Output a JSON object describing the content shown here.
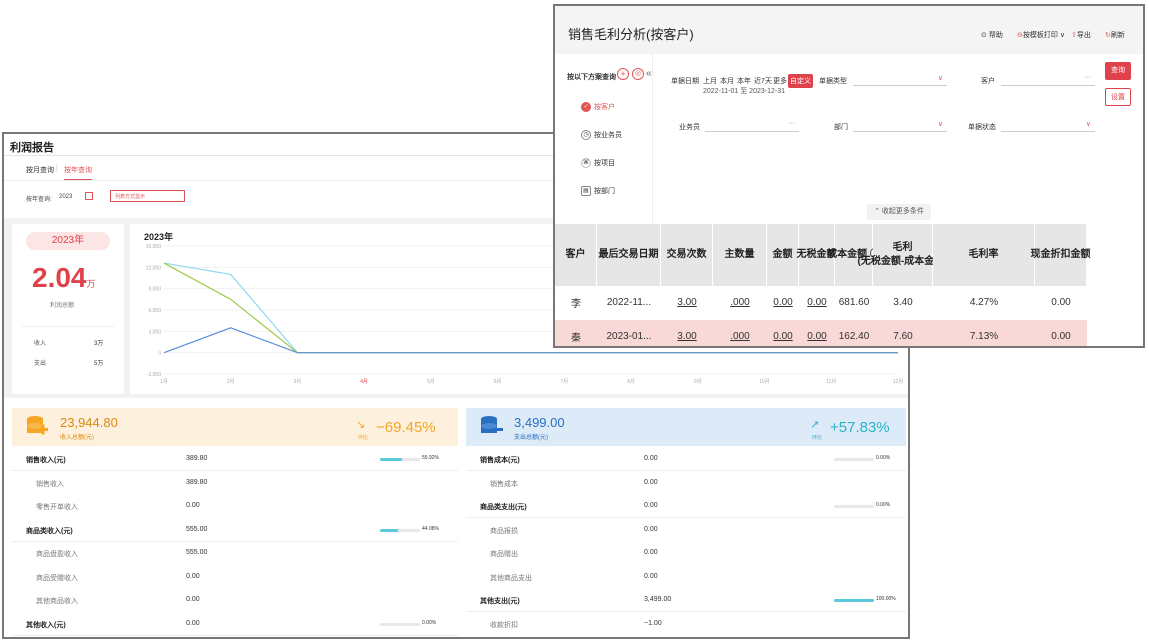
{
  "profit_report": {
    "title": "利润报告",
    "tabs": [
      "按月查询",
      "按年查询"
    ],
    "year_label": "按年查询:",
    "year_value": "2023",
    "list_btn": "列表方式显示",
    "summary": {
      "year": "2023年",
      "big_value": "2.04",
      "big_unit": "万",
      "big_label": "利润总额",
      "income_label": "收入",
      "income_value": "3万",
      "expense_label": "支出",
      "expense_value": "5万"
    },
    "chart_data": {
      "type": "line",
      "title": "2023年",
      "categories": [
        "1月",
        "2月",
        "3月",
        "4月",
        "5月",
        "6月",
        "7月",
        "8月",
        "9月",
        "10月",
        "11月",
        "12月"
      ],
      "highlight_category": "4月",
      "yticks": [
        "15,000",
        "12,000",
        "9,000",
        "6,000",
        "3,000",
        "0",
        "-3,000"
      ],
      "ylim": [
        -3000,
        15000
      ],
      "series": [
        {
          "color": "#8fd8ee",
          "values": [
            12600,
            11000,
            0,
            0,
            0,
            0,
            0,
            0,
            0,
            0,
            0,
            0
          ]
        },
        {
          "color": "#9bcb46",
          "values": [
            12600,
            7500,
            0,
            0,
            0,
            0,
            0,
            0,
            0,
            0,
            0,
            0
          ]
        },
        {
          "color": "#5b8fd9",
          "values": [
            0,
            3500,
            0,
            0,
            0,
            0,
            0,
            0,
            0,
            0,
            0,
            0
          ]
        }
      ]
    },
    "income": {
      "amount": "23,944.80",
      "amount_label": "收入总额(元)",
      "hb": "环比",
      "pct": "−69.45%",
      "rows": [
        {
          "name": "销售收入(元)",
          "value": "389.80",
          "pct": "55.92%",
          "fill": 0.56,
          "bold": true
        },
        {
          "name": "销售收入",
          "value": "389.80"
        },
        {
          "name": "零售开单收入",
          "value": "0.00"
        },
        {
          "name": "商品类收入(元)",
          "value": "555.00",
          "pct": "44.08%",
          "fill": 0.44,
          "bold": true
        },
        {
          "name": "商品盘盈收入",
          "value": "555.00"
        },
        {
          "name": "商品受赠收入",
          "value": "0.00"
        },
        {
          "name": "其他商品收入",
          "value": "0.00"
        },
        {
          "name": "其他收入(元)",
          "value": "0.00",
          "pct": "0.00%",
          "fill": 0,
          "bold": true
        }
      ]
    },
    "expense": {
      "amount": "3,499.00",
      "amount_label": "支出总额(元)",
      "hb": "环比",
      "pct": "+57.83%",
      "rows": [
        {
          "name": "销售成本(元)",
          "value": "0.00",
          "pct": "0.00%",
          "fill": 0,
          "bold": true
        },
        {
          "name": "销售成本",
          "value": "0.00"
        },
        {
          "name": "商品类支出(元)",
          "value": "0.00",
          "pct": "0.00%",
          "fill": 0,
          "bold": true
        },
        {
          "name": "商品报损",
          "value": "0.00"
        },
        {
          "name": "商品赠出",
          "value": "0.00"
        },
        {
          "name": "其他商品支出",
          "value": "0.00"
        },
        {
          "name": "其他支出(元)",
          "value": "3,499.00",
          "pct": "100.00%",
          "fill": 1,
          "bold": true
        },
        {
          "name": "收款折扣",
          "value": "−1.00"
        }
      ]
    }
  },
  "sales": {
    "title": "销售毛利分析(按客户)",
    "actions": {
      "help": "帮助",
      "print": "按模板打印",
      "export": "导出",
      "refresh": "刷新"
    },
    "scheme_label": "按以下方案查询",
    "left_items": [
      "按客户",
      "按业务员",
      "按项目",
      "按部门"
    ],
    "date_label": "单据日期",
    "date_opts": [
      "上月",
      "本月",
      "本年",
      "近7天",
      "更多",
      "自定义"
    ],
    "date_range": "2022-11-01 至 2023-12-31",
    "fields": {
      "type": "单据类型",
      "customer": "客户",
      "salesman": "业务员",
      "dept": "部门",
      "status": "单据状态"
    },
    "query_btn": "查询",
    "settings_btn": "设置",
    "collapse": "收起更多条件",
    "columns": [
      "客户",
      "最后交易日期",
      "交易次数",
      "主数量",
      "金额",
      "无税金额",
      "成本金额 ⓘ",
      "毛利\n(无税金额-成本金额)",
      "毛利率",
      "现金折扣金额"
    ],
    "rows": [
      [
        "李",
        "2022-11...",
        "3.00",
        ".000",
        "0.00",
        "0.00",
        "681.60",
        "3.40",
        "4.27%",
        "0.00"
      ],
      [
        "秦",
        "2023-01...",
        "3.00",
        ".000",
        "0.00",
        "0.00",
        "162.40",
        "7.60",
        "7.13%",
        "0.00"
      ]
    ]
  }
}
